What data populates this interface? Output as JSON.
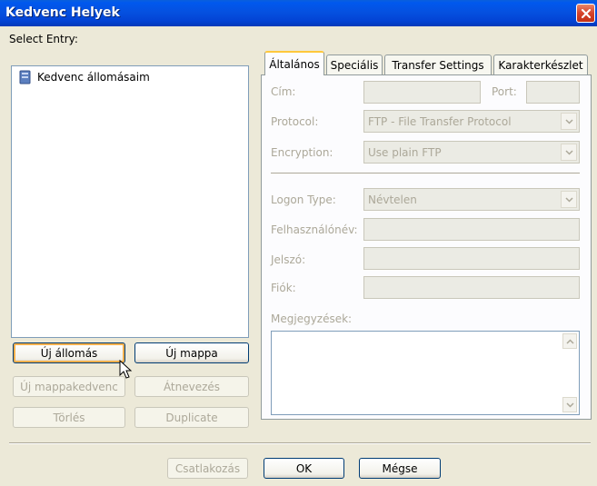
{
  "window": {
    "title": "Kedvenc Helyek"
  },
  "left": {
    "select_label": "Select Entry:",
    "tree_items": [
      {
        "label": "Kedvenc állomásaim",
        "icon": "server-folder-icon"
      }
    ],
    "buttons": {
      "new_site": "Új állomás",
      "new_folder": "Új mappa",
      "new_bookmark": "Új mappakedvenc",
      "rename": "Átnevezés",
      "delete": "Törlés",
      "duplicate": "Duplicate"
    }
  },
  "tabs": [
    {
      "label": "Általános",
      "active": true
    },
    {
      "label": "Speciális",
      "active": false
    },
    {
      "label": "Transfer Settings",
      "active": false
    },
    {
      "label": "Karakterkészlet",
      "active": false
    }
  ],
  "general": {
    "host_label": "Cím:",
    "host_value": "",
    "port_label": "Port:",
    "port_value": "",
    "protocol_label": "Protocol:",
    "protocol_value": "FTP - File Transfer Protocol",
    "encryption_label": "Encryption:",
    "encryption_value": "Use plain FTP",
    "logon_type_label": "Logon Type:",
    "logon_type_value": "Névtelen",
    "user_label": "Felhasználónév:",
    "user_value": "",
    "password_label": "Jelszó:",
    "password_value": "",
    "account_label": "Fiók:",
    "account_value": "",
    "comments_label": "Megjegyzések:",
    "comments_value": ""
  },
  "footer": {
    "connect": "Csatlakozás",
    "ok": "OK",
    "cancel": "Mégse"
  },
  "colors": {
    "titlebar": "#0551e0",
    "focus_ring": "#f5b04c",
    "tab_highlight": "#ffc83c",
    "disabled_text": "#aca899"
  }
}
